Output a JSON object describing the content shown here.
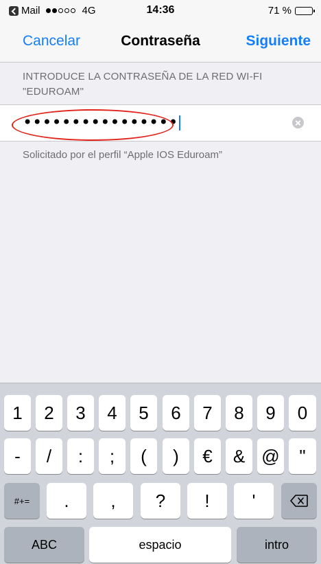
{
  "status_bar": {
    "back_app": "Mail",
    "carrier_signal": "4G",
    "time": "14:36",
    "battery_pct": "71 %",
    "battery_fill": 0.71,
    "icons": [
      "back-to-app-icon",
      "signal-dots-icon",
      "battery-icon"
    ]
  },
  "nav": {
    "cancel_label": "Cancelar",
    "title": "Contraseña",
    "next_label": "Siguiente"
  },
  "section_header": "INTRODUCE LA CONTRASEÑA DE LA RED WI-FI \"EDUROAM\"",
  "password_field": {
    "masked_value": "••••••••••••••••",
    "clear_icon": "clear-icon"
  },
  "footer_note": "Solicitado por el perfil “Apple IOS Eduroam”",
  "keyboard": {
    "row1": [
      "1",
      "2",
      "3",
      "4",
      "5",
      "6",
      "7",
      "8",
      "9",
      "0"
    ],
    "row2": [
      "-",
      "/",
      ":",
      ";",
      "(",
      ")",
      "€",
      "&",
      "@",
      "\""
    ],
    "row3_mode": "#+=",
    "row3": [
      ".",
      ",",
      "?",
      "!",
      "'"
    ],
    "backspace_icon": "backspace-icon",
    "abc_label": "ABC",
    "space_label": "espacio",
    "return_label": "intro"
  },
  "colors": {
    "accent": "#147efb",
    "highlight": "#e2231a",
    "background": "#efeff4"
  }
}
